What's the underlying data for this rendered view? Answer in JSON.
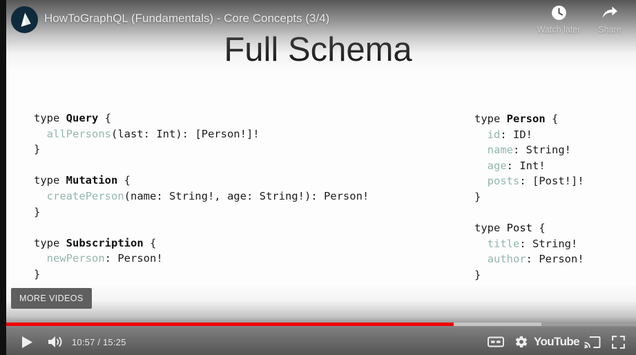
{
  "player": {
    "video_title": "HowToGraphQL (Fundamentals) - Core Concepts (3/4)",
    "channel_avatar_icon": "prisma-logo-icon",
    "top_actions": [
      {
        "label": "Watch later",
        "icon": "clock-icon"
      },
      {
        "label": "Share",
        "icon": "share-arrow-icon"
      }
    ],
    "more_videos_label": "MORE VIDEOS",
    "time_display": "10:57 / 15:25",
    "current_time": "10:57",
    "duration": "15:25",
    "progress_percent": 71,
    "loaded_percent": 85,
    "controls": {
      "play_icon": "play-icon",
      "volume_icon": "volume-on-icon",
      "cc_icon": "closed-captions-icon",
      "settings_icon": "gear-icon",
      "youtube_label": "YouTube",
      "cast_icon": "cast-icon",
      "fullscreen_icon": "fullscreen-icon"
    },
    "colors": {
      "progress_played": "#f00000",
      "progress_loaded": "#c6c6c6",
      "progress_track": "#9c9c9c",
      "more_videos_bg": "#5f5f5f",
      "avatar_bg": "#0e2a3c"
    }
  },
  "slide": {
    "title": "Full Schema",
    "code_colors": {
      "keyword": "#1d1d1d",
      "type_name": "#101010",
      "field_name": "#93b7af"
    },
    "left_column": [
      {
        "name": "query-type-block",
        "lines": [
          [
            {
              "t": "type ",
              "c": "kw"
            },
            {
              "t": "Query",
              "c": "tname"
            },
            {
              "t": " {",
              "c": "punc"
            }
          ],
          [
            {
              "t": "  ",
              "c": "punc"
            },
            {
              "t": "allPersons",
              "c": "fld"
            },
            {
              "t": "(last: Int): [Person!]!",
              "c": "punc"
            }
          ],
          [
            {
              "t": "}",
              "c": "punc"
            }
          ]
        ]
      },
      {
        "name": "mutation-type-block",
        "lines": [
          [
            {
              "t": "type ",
              "c": "kw"
            },
            {
              "t": "Mutation",
              "c": "tname"
            },
            {
              "t": " {",
              "c": "punc"
            }
          ],
          [
            {
              "t": "  ",
              "c": "punc"
            },
            {
              "t": "createPerson",
              "c": "fld"
            },
            {
              "t": "(name: String!, age: String!): Person!",
              "c": "punc"
            }
          ],
          [
            {
              "t": "}",
              "c": "punc"
            }
          ]
        ]
      },
      {
        "name": "subscription-type-block",
        "lines": [
          [
            {
              "t": "type ",
              "c": "kw"
            },
            {
              "t": "Subscription",
              "c": "tname"
            },
            {
              "t": " {",
              "c": "punc"
            }
          ],
          [
            {
              "t": "  ",
              "c": "punc"
            },
            {
              "t": "newPerson",
              "c": "fld"
            },
            {
              "t": ": Person!",
              "c": "punc"
            }
          ],
          [
            {
              "t": "}",
              "c": "punc"
            }
          ]
        ]
      }
    ],
    "right_column": [
      {
        "name": "person-type-block",
        "lines": [
          [
            {
              "t": "type ",
              "c": "kw"
            },
            {
              "t": "Person",
              "c": "tname"
            },
            {
              "t": " {",
              "c": "punc"
            }
          ],
          [
            {
              "t": "  ",
              "c": "punc"
            },
            {
              "t": "id",
              "c": "fld"
            },
            {
              "t": ": ID!",
              "c": "punc"
            }
          ],
          [
            {
              "t": "  ",
              "c": "punc"
            },
            {
              "t": "name",
              "c": "fld"
            },
            {
              "t": ": String!",
              "c": "punc"
            }
          ],
          [
            {
              "t": "  ",
              "c": "punc"
            },
            {
              "t": "age",
              "c": "fld"
            },
            {
              "t": ": Int!",
              "c": "punc"
            }
          ],
          [
            {
              "t": "  ",
              "c": "punc"
            },
            {
              "t": "posts",
              "c": "fld"
            },
            {
              "t": ": [Post!]!",
              "c": "punc"
            }
          ],
          [
            {
              "t": "}",
              "c": "punc"
            }
          ]
        ]
      },
      {
        "name": "post-type-block",
        "lines": [
          [
            {
              "t": "type ",
              "c": "kw"
            },
            {
              "t": "Post",
              "c": "tname-n"
            },
            {
              "t": " {",
              "c": "punc"
            }
          ],
          [
            {
              "t": "  ",
              "c": "punc"
            },
            {
              "t": "title",
              "c": "fld"
            },
            {
              "t": ": String!",
              "c": "punc"
            }
          ],
          [
            {
              "t": "  ",
              "c": "punc"
            },
            {
              "t": "author",
              "c": "fld"
            },
            {
              "t": ": Person!",
              "c": "punc"
            }
          ],
          [
            {
              "t": "}",
              "c": "punc"
            }
          ]
        ]
      }
    ]
  }
}
